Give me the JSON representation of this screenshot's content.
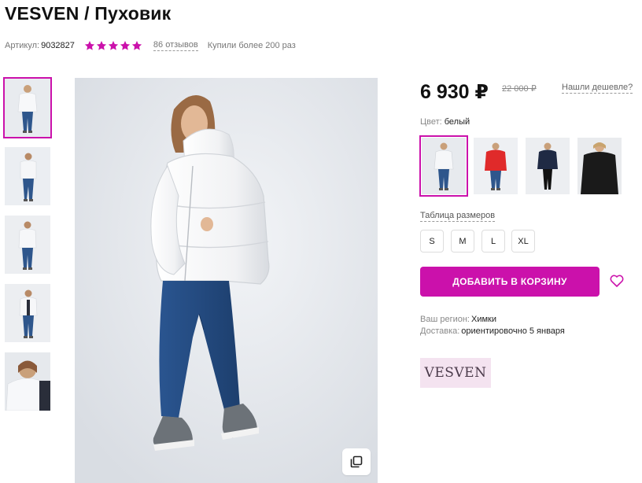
{
  "product": {
    "title": "VESVEN / Пуховик",
    "sku_label": "Артикул:",
    "sku_value": "9032827",
    "rating": 5,
    "reviews_label": "86 отзывов",
    "bought_label": "Купили более 200 раз"
  },
  "pricing": {
    "current": "6 930 ₽",
    "old": "22 000 ₽",
    "cheaper_link": "Нашли дешевле?"
  },
  "color": {
    "label": "Цвет:",
    "value": "белый",
    "swatches": [
      {
        "name": "white",
        "jacket": "#f3f4f6",
        "active": true
      },
      {
        "name": "red",
        "jacket": "#e02a2a",
        "active": false
      },
      {
        "name": "navy",
        "jacket": "#1f2a44",
        "active": false
      },
      {
        "name": "black",
        "jacket": "#1a1a1a",
        "active": false
      }
    ]
  },
  "sizes": {
    "table_link": "Таблица размеров",
    "options": [
      "S",
      "M",
      "L",
      "XL"
    ]
  },
  "cart": {
    "add_label": "ДОБАВИТЬ В КОРЗИНУ"
  },
  "delivery": {
    "region_label": "Ваш регион:",
    "region_value": "Химки",
    "delivery_label": "Доставка:",
    "delivery_value": "ориентировочно 5 января"
  },
  "brand": {
    "logo_text": "VESVEN"
  },
  "icons": {
    "star": "star-icon",
    "heart": "heart-icon",
    "zoom": "expand-icon"
  },
  "colors": {
    "accent": "#cb11ab",
    "brand_bg": "#f4e3f0"
  }
}
